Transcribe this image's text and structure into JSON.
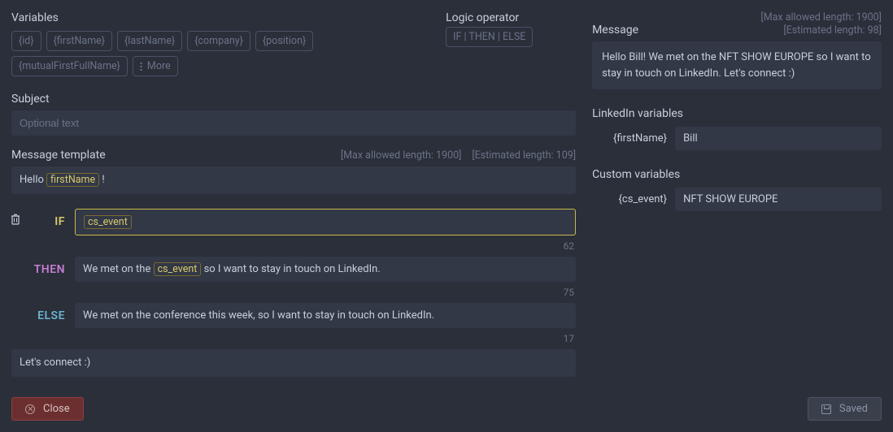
{
  "variables": {
    "label": "Variables",
    "chips": [
      "{id}",
      "{firstName}",
      "{lastName}",
      "{company}",
      "{position}",
      "{mutualFirstFullName}"
    ],
    "more_label": "More"
  },
  "logic_operator": {
    "label": "Logic operator",
    "chip": "IF | THEN | ELSE"
  },
  "subject": {
    "label": "Subject",
    "placeholder": "Optional text",
    "value": ""
  },
  "template": {
    "label": "Message template",
    "max_label": "[Max allowed length: 1900]",
    "est_label": "[Estimated length: 109]",
    "greeting_prefix": "Hello ",
    "greeting_var": "firstName",
    "greeting_suffix": " !",
    "if_var": "cs_event",
    "then_prefix": "We met on the ",
    "then_var": "cs_event",
    "then_suffix": " so I want to stay in touch on LinkedIn.",
    "else_text": "We met on the conference this week, so I want to stay in touch on LinkedIn.",
    "closing": "Let's connect :)",
    "count_if": "62",
    "count_then": "75",
    "count_else": "17",
    "logic_labels": {
      "if": "IF",
      "then": "THEN",
      "else": "ELSE"
    }
  },
  "preview": {
    "max_label": "[Max allowed length: 1900]",
    "message_label": "Message",
    "est_label": "[Estimated length: 98]",
    "message_text": "Hello Bill! We met on the NFT SHOW EUROPE so I want to stay in touch on LinkedIn. Let's connect :)"
  },
  "linkedin_vars": {
    "label": "LinkedIn variables",
    "items": [
      {
        "key": "{firstName}",
        "value": "Bill"
      }
    ]
  },
  "custom_vars": {
    "label": "Custom variables",
    "items": [
      {
        "key": "{cs_event}",
        "value": "NFT SHOW EUROPE"
      }
    ]
  },
  "footer": {
    "close": "Close",
    "saved": "Saved"
  }
}
